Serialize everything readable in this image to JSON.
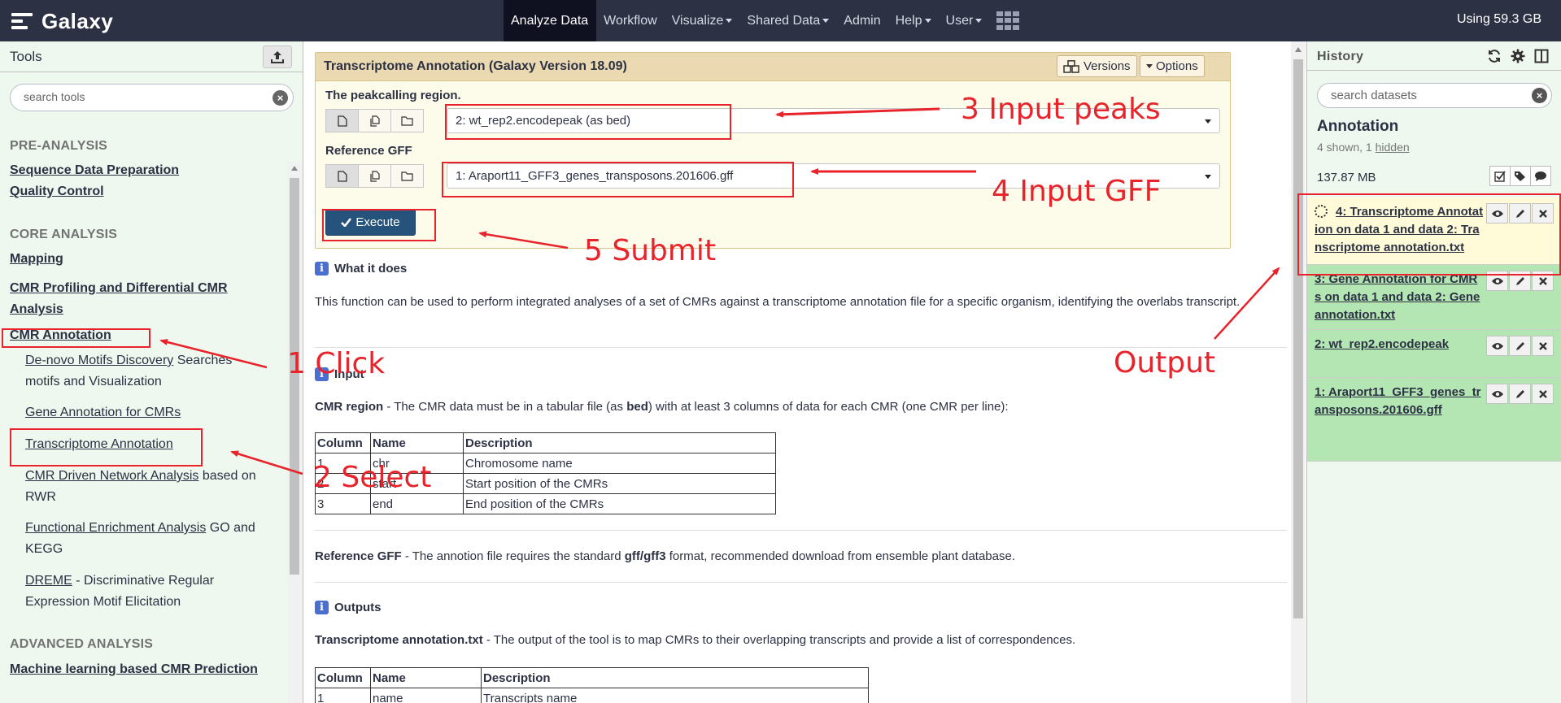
{
  "navbar": {
    "brand": "Galaxy",
    "items": [
      {
        "label": "Analyze Data",
        "caret": false
      },
      {
        "label": "Workflow",
        "caret": false
      },
      {
        "label": "Visualize",
        "caret": true
      },
      {
        "label": "Shared Data",
        "caret": true
      },
      {
        "label": "Admin",
        "caret": false
      },
      {
        "label": "Help",
        "caret": true
      },
      {
        "label": "User",
        "caret": true
      }
    ],
    "quota": "Using 59.3 GB"
  },
  "tools": {
    "title": "Tools",
    "search_placeholder": "search tools",
    "sections": {
      "pre": "PRE-ANALYSIS",
      "core": "CORE ANALYSIS",
      "advanced": "ADVANCED ANALYSIS"
    },
    "categories": {
      "seq": "Sequence Data Preparation",
      "qc": "Quality Control",
      "mapping": "Mapping",
      "profiling": "CMR Profiling and Differential CMR Analysis",
      "annotation": "CMR Annotation",
      "ml": "Machine learning based CMR Prediction"
    },
    "items": {
      "denovo_link": "De-novo Motifs Discovery",
      "denovo_desc": " Searches motifs and Visualization",
      "gene": "Gene Annotation for CMRs",
      "transcriptome": "Transcriptome Annotation",
      "network_link": "CMR Driven Network Analysis",
      "network_desc": " based on RWR",
      "enrich_link": "Functional Enrichment Analysis",
      "enrich_desc": " GO and KEGG",
      "dreme_link": "DREME",
      "dreme_desc": " - Discriminative Regular Expression Motif Elicitation"
    }
  },
  "form": {
    "title": "Transcriptome Annotation (Galaxy Version 18.09)",
    "versions_label": "Versions",
    "options_label": "Options",
    "param1_label": "The peakcalling region.",
    "param1_value": "2: wt_rep2.encodepeak (as bed)",
    "param2_label": "Reference GFF",
    "param2_value": "1: Araport11_GFF3_genes_transposons.201606.gff",
    "execute_label": "Execute"
  },
  "help": {
    "what_title": "What it does",
    "what_text": "This function can be used to perform integrated analyses of a set of CMRs against a transcriptome annotation file for a specific organism, identifying the overlabs transcript.",
    "input_title": "Input",
    "cmr_region_bold": "CMR region",
    "cmr_region_text1": " - The CMR data must be in a tabular file (as ",
    "cmr_region_bed": "bed",
    "cmr_region_text2": ") with at least 3 columns of data for each CMR (one CMR per line):",
    "input_table": {
      "headers": [
        "Column",
        "Name",
        "Description"
      ],
      "rows": [
        [
          "1",
          "chr",
          "Chromosome name"
        ],
        [
          "2",
          "start",
          "Start position of the CMRs"
        ],
        [
          "3",
          "end",
          "End position of the CMRs"
        ]
      ]
    },
    "ref_gff_bold": "Reference GFF",
    "ref_gff_text1": " - The annotion file requires the standard ",
    "ref_gff_fmt": "gff/gff3",
    "ref_gff_text2": " format, recommended download from ensemble plant database.",
    "outputs_title": "Outputs",
    "out_bold": "Transcriptome annotation.txt",
    "out_text": " - The output of the tool is to map CMRs to their overlapping transcripts and provide a list of correspondences.",
    "output_table": {
      "headers": [
        "Column",
        "Name",
        "Description"
      ],
      "rows": [
        [
          "1",
          "name",
          "Transcripts name"
        ]
      ]
    }
  },
  "history": {
    "title": "History",
    "search_placeholder": "search datasets",
    "name": "Annotation",
    "count_prefix": "4 shown, 1 ",
    "count_hidden": "hidden",
    "size": "137.87 MB",
    "datasets": [
      {
        "name": "4: Transcriptome Annotation on data 1 and data 2: Transcriptome annotation.txt",
        "state": "queued"
      },
      {
        "name": "3: Gene Annotation for CMRs on data 1 and data 2: Gene annotation.txt",
        "state": "ok"
      },
      {
        "name": "2: wt_rep2.encodepeak",
        "state": "ok"
      },
      {
        "name": "1: Araport11_GFF3_genes_transposons.201606.gff",
        "state": "ok"
      }
    ]
  },
  "annotations": {
    "a1": "1 Click",
    "a2": "2 Select",
    "a3": "3 Input peaks",
    "a4": "4 Input GFF",
    "a5": "5 Submit",
    "a6": "Output",
    "color": "#e8232b"
  },
  "colors": {
    "navbar": "#2c3143",
    "tool_panel_bg": "#eff8ee",
    "form_header": "#ebd9b2",
    "execute": "#25537b",
    "dataset_ok": "#b3e6b3",
    "dataset_queued": "#fffbd8"
  }
}
